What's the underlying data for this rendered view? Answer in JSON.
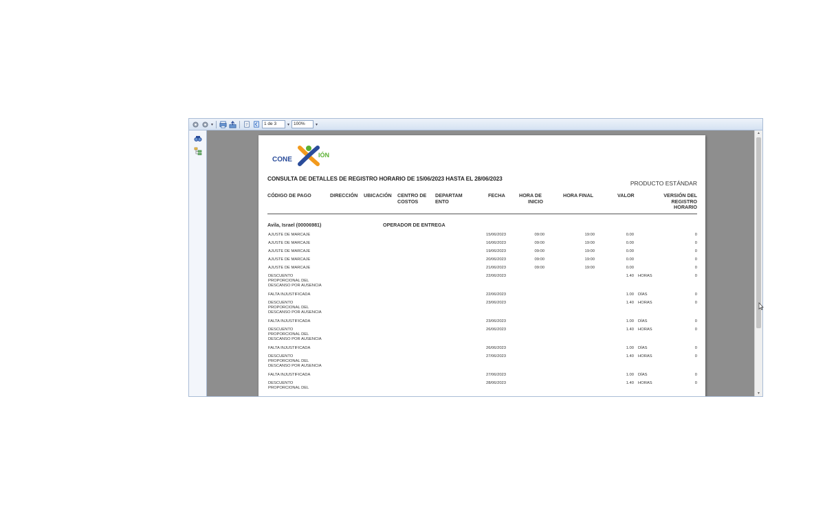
{
  "toolbar": {
    "page_indicator": "1 de 3",
    "zoom": "100%"
  },
  "report": {
    "logo_text_left": "CONE",
    "logo_text_right": "IÓN",
    "title": "CONSULTA DE DETALLES DE REGISTRO HORARIO DE 15/06/2023 HASTA EL 28/06/2023",
    "product": "PRODUCTO ESTÁNDAR",
    "columns": {
      "codigo": "CÓDIGO DE PAGO",
      "direccion": "DIRECCIÓN",
      "ubicacion": "UBICACIÓN",
      "centro_1": "CENTRO DE",
      "centro_2": "COSTOS",
      "depto_1": "DEPARTAM",
      "depto_2": "ENTO",
      "fecha": "FECHA",
      "inicio_1": "HORA DE",
      "inicio_2": "INICIO",
      "final": "HORA FINAL",
      "valor": "VALOR",
      "version_1": "VERSIÓN DEL",
      "version_2": "REGISTRO",
      "version_3": "HORARIO"
    },
    "employee": {
      "name": "Avila, Israel (00006981)",
      "role": "OPERADOR DE ENTREGA"
    },
    "rows": [
      {
        "code": [
          "AJUSTE DE MARCAJE"
        ],
        "date": "15/06/2023",
        "start": "09:00",
        "end": "19:00",
        "value": "0.00",
        "unit": "",
        "version": "0"
      },
      {
        "code": [
          "AJUSTE DE MARCAJE"
        ],
        "date": "16/06/2023",
        "start": "09:00",
        "end": "19:00",
        "value": "0.00",
        "unit": "",
        "version": "0"
      },
      {
        "code": [
          "AJUSTE DE MARCAJE"
        ],
        "date": "19/06/2023",
        "start": "09:00",
        "end": "19:00",
        "value": "0.00",
        "unit": "",
        "version": "0"
      },
      {
        "code": [
          "AJUSTE DE MARCAJE"
        ],
        "date": "20/06/2023",
        "start": "09:00",
        "end": "19:00",
        "value": "0.00",
        "unit": "",
        "version": "0"
      },
      {
        "code": [
          "AJUSTE DE MARCAJE"
        ],
        "date": "21/06/2023",
        "start": "09:00",
        "end": "19:00",
        "value": "0.00",
        "unit": "",
        "version": "0"
      },
      {
        "code": [
          "DESCUENTO",
          "PROPORCIONAL DEL",
          "DESCANSO POR AUSENCIA"
        ],
        "date": "22/06/2023",
        "start": "",
        "end": "",
        "value": "1.40",
        "unit": "HORAS",
        "version": "0"
      },
      {
        "code": [
          "FALTA INJUSTIFICADA"
        ],
        "date": "22/06/2023",
        "start": "",
        "end": "",
        "value": "1.00",
        "unit": "DÍAS",
        "version": "0"
      },
      {
        "code": [
          "DESCUENTO",
          "PROPORCIONAL DEL",
          "DESCANSO POR AUSENCIA"
        ],
        "date": "23/06/2023",
        "start": "",
        "end": "",
        "value": "1.40",
        "unit": "HORAS",
        "version": "0"
      },
      {
        "code": [
          "FALTA INJUSTIFICADA"
        ],
        "date": "23/06/2023",
        "start": "",
        "end": "",
        "value": "1.00",
        "unit": "DÍAS",
        "version": "0"
      },
      {
        "code": [
          "DESCUENTO",
          "PROPORCIONAL DEL",
          "DESCANSO POR AUSENCIA"
        ],
        "date": "26/06/2023",
        "start": "",
        "end": "",
        "value": "1.40",
        "unit": "HORAS",
        "version": "0"
      },
      {
        "code": [
          "FALTA INJUSTIFICADA"
        ],
        "date": "26/06/2023",
        "start": "",
        "end": "",
        "value": "1.00",
        "unit": "DÍAS",
        "version": "0"
      },
      {
        "code": [
          "DESCUENTO",
          "PROPORCIONAL DEL",
          "DESCANSO POR AUSENCIA"
        ],
        "date": "27/06/2023",
        "start": "",
        "end": "",
        "value": "1.40",
        "unit": "HORAS",
        "version": "0"
      },
      {
        "code": [
          "FALTA INJUSTIFICADA"
        ],
        "date": "27/06/2023",
        "start": "",
        "end": "",
        "value": "1.00",
        "unit": "DÍAS",
        "version": "0"
      },
      {
        "code": [
          "DESCUENTO",
          "PROPORCIONAL DEL"
        ],
        "date": "28/06/2023",
        "start": "",
        "end": "",
        "value": "1.40",
        "unit": "HORAS",
        "version": "0"
      }
    ]
  },
  "colors": {
    "logo_blue": "#2a4c9a",
    "logo_green": "#5ab031",
    "logo_orange": "#f29a1d",
    "canvas_gray": "#8e8e8e"
  },
  "icons": [
    "back-icon",
    "forward-icon",
    "print-icon",
    "export-icon",
    "first-page-icon",
    "prev-page-icon",
    "search-icon",
    "tree-icon"
  ]
}
